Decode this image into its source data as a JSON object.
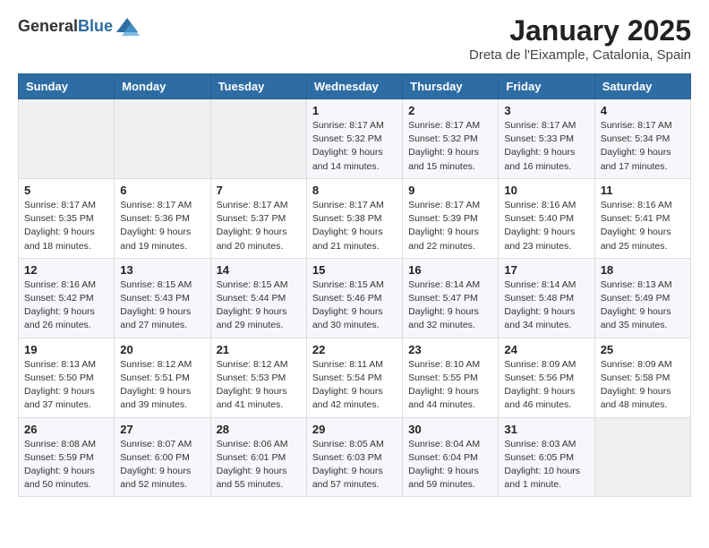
{
  "header": {
    "logo_general": "General",
    "logo_blue": "Blue",
    "title": "January 2025",
    "subtitle": "Dreta de l'Eixample, Catalonia, Spain"
  },
  "weekdays": [
    "Sunday",
    "Monday",
    "Tuesday",
    "Wednesday",
    "Thursday",
    "Friday",
    "Saturday"
  ],
  "weeks": [
    [
      {
        "day": "",
        "sunrise": "",
        "sunset": "",
        "daylight": "",
        "empty": true
      },
      {
        "day": "",
        "sunrise": "",
        "sunset": "",
        "daylight": "",
        "empty": true
      },
      {
        "day": "",
        "sunrise": "",
        "sunset": "",
        "daylight": "",
        "empty": true
      },
      {
        "day": "1",
        "sunrise": "Sunrise: 8:17 AM",
        "sunset": "Sunset: 5:32 PM",
        "daylight": "Daylight: 9 hours and 14 minutes.",
        "empty": false
      },
      {
        "day": "2",
        "sunrise": "Sunrise: 8:17 AM",
        "sunset": "Sunset: 5:32 PM",
        "daylight": "Daylight: 9 hours and 15 minutes.",
        "empty": false
      },
      {
        "day": "3",
        "sunrise": "Sunrise: 8:17 AM",
        "sunset": "Sunset: 5:33 PM",
        "daylight": "Daylight: 9 hours and 16 minutes.",
        "empty": false
      },
      {
        "day": "4",
        "sunrise": "Sunrise: 8:17 AM",
        "sunset": "Sunset: 5:34 PM",
        "daylight": "Daylight: 9 hours and 17 minutes.",
        "empty": false
      }
    ],
    [
      {
        "day": "5",
        "sunrise": "Sunrise: 8:17 AM",
        "sunset": "Sunset: 5:35 PM",
        "daylight": "Daylight: 9 hours and 18 minutes.",
        "empty": false
      },
      {
        "day": "6",
        "sunrise": "Sunrise: 8:17 AM",
        "sunset": "Sunset: 5:36 PM",
        "daylight": "Daylight: 9 hours and 19 minutes.",
        "empty": false
      },
      {
        "day": "7",
        "sunrise": "Sunrise: 8:17 AM",
        "sunset": "Sunset: 5:37 PM",
        "daylight": "Daylight: 9 hours and 20 minutes.",
        "empty": false
      },
      {
        "day": "8",
        "sunrise": "Sunrise: 8:17 AM",
        "sunset": "Sunset: 5:38 PM",
        "daylight": "Daylight: 9 hours and 21 minutes.",
        "empty": false
      },
      {
        "day": "9",
        "sunrise": "Sunrise: 8:17 AM",
        "sunset": "Sunset: 5:39 PM",
        "daylight": "Daylight: 9 hours and 22 minutes.",
        "empty": false
      },
      {
        "day": "10",
        "sunrise": "Sunrise: 8:16 AM",
        "sunset": "Sunset: 5:40 PM",
        "daylight": "Daylight: 9 hours and 23 minutes.",
        "empty": false
      },
      {
        "day": "11",
        "sunrise": "Sunrise: 8:16 AM",
        "sunset": "Sunset: 5:41 PM",
        "daylight": "Daylight: 9 hours and 25 minutes.",
        "empty": false
      }
    ],
    [
      {
        "day": "12",
        "sunrise": "Sunrise: 8:16 AM",
        "sunset": "Sunset: 5:42 PM",
        "daylight": "Daylight: 9 hours and 26 minutes.",
        "empty": false
      },
      {
        "day": "13",
        "sunrise": "Sunrise: 8:15 AM",
        "sunset": "Sunset: 5:43 PM",
        "daylight": "Daylight: 9 hours and 27 minutes.",
        "empty": false
      },
      {
        "day": "14",
        "sunrise": "Sunrise: 8:15 AM",
        "sunset": "Sunset: 5:44 PM",
        "daylight": "Daylight: 9 hours and 29 minutes.",
        "empty": false
      },
      {
        "day": "15",
        "sunrise": "Sunrise: 8:15 AM",
        "sunset": "Sunset: 5:46 PM",
        "daylight": "Daylight: 9 hours and 30 minutes.",
        "empty": false
      },
      {
        "day": "16",
        "sunrise": "Sunrise: 8:14 AM",
        "sunset": "Sunset: 5:47 PM",
        "daylight": "Daylight: 9 hours and 32 minutes.",
        "empty": false
      },
      {
        "day": "17",
        "sunrise": "Sunrise: 8:14 AM",
        "sunset": "Sunset: 5:48 PM",
        "daylight": "Daylight: 9 hours and 34 minutes.",
        "empty": false
      },
      {
        "day": "18",
        "sunrise": "Sunrise: 8:13 AM",
        "sunset": "Sunset: 5:49 PM",
        "daylight": "Daylight: 9 hours and 35 minutes.",
        "empty": false
      }
    ],
    [
      {
        "day": "19",
        "sunrise": "Sunrise: 8:13 AM",
        "sunset": "Sunset: 5:50 PM",
        "daylight": "Daylight: 9 hours and 37 minutes.",
        "empty": false
      },
      {
        "day": "20",
        "sunrise": "Sunrise: 8:12 AM",
        "sunset": "Sunset: 5:51 PM",
        "daylight": "Daylight: 9 hours and 39 minutes.",
        "empty": false
      },
      {
        "day": "21",
        "sunrise": "Sunrise: 8:12 AM",
        "sunset": "Sunset: 5:53 PM",
        "daylight": "Daylight: 9 hours and 41 minutes.",
        "empty": false
      },
      {
        "day": "22",
        "sunrise": "Sunrise: 8:11 AM",
        "sunset": "Sunset: 5:54 PM",
        "daylight": "Daylight: 9 hours and 42 minutes.",
        "empty": false
      },
      {
        "day": "23",
        "sunrise": "Sunrise: 8:10 AM",
        "sunset": "Sunset: 5:55 PM",
        "daylight": "Daylight: 9 hours and 44 minutes.",
        "empty": false
      },
      {
        "day": "24",
        "sunrise": "Sunrise: 8:09 AM",
        "sunset": "Sunset: 5:56 PM",
        "daylight": "Daylight: 9 hours and 46 minutes.",
        "empty": false
      },
      {
        "day": "25",
        "sunrise": "Sunrise: 8:09 AM",
        "sunset": "Sunset: 5:58 PM",
        "daylight": "Daylight: 9 hours and 48 minutes.",
        "empty": false
      }
    ],
    [
      {
        "day": "26",
        "sunrise": "Sunrise: 8:08 AM",
        "sunset": "Sunset: 5:59 PM",
        "daylight": "Daylight: 9 hours and 50 minutes.",
        "empty": false
      },
      {
        "day": "27",
        "sunrise": "Sunrise: 8:07 AM",
        "sunset": "Sunset: 6:00 PM",
        "daylight": "Daylight: 9 hours and 52 minutes.",
        "empty": false
      },
      {
        "day": "28",
        "sunrise": "Sunrise: 8:06 AM",
        "sunset": "Sunset: 6:01 PM",
        "daylight": "Daylight: 9 hours and 55 minutes.",
        "empty": false
      },
      {
        "day": "29",
        "sunrise": "Sunrise: 8:05 AM",
        "sunset": "Sunset: 6:03 PM",
        "daylight": "Daylight: 9 hours and 57 minutes.",
        "empty": false
      },
      {
        "day": "30",
        "sunrise": "Sunrise: 8:04 AM",
        "sunset": "Sunset: 6:04 PM",
        "daylight": "Daylight: 9 hours and 59 minutes.",
        "empty": false
      },
      {
        "day": "31",
        "sunrise": "Sunrise: 8:03 AM",
        "sunset": "Sunset: 6:05 PM",
        "daylight": "Daylight: 10 hours and 1 minute.",
        "empty": false
      },
      {
        "day": "",
        "sunrise": "",
        "sunset": "",
        "daylight": "",
        "empty": true
      }
    ]
  ]
}
